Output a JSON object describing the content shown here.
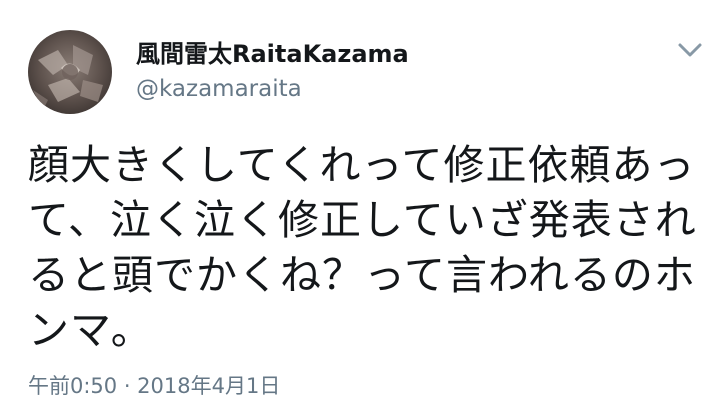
{
  "author": {
    "display_name": "風間雷太RaitaKazama",
    "handle": "@kazamaraita"
  },
  "tweet": {
    "text": "顔大きくしてくれって修正依頼あって、泣く泣く修正していざ発表されると頭でかくね？って言われるのホンマ。"
  },
  "meta": {
    "timestamp": "午前0:50 · 2018年4月1日"
  },
  "icons": {
    "avatar": "avatar-illustration",
    "menu": "chevron-down-icon"
  }
}
